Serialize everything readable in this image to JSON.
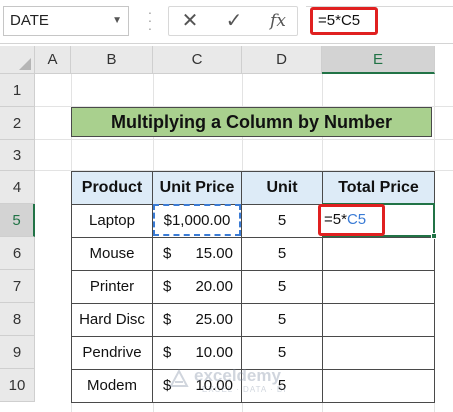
{
  "formula_bar": {
    "name_box": "DATE",
    "name_box_dropdown_icon": "chevron-down-icon",
    "cancel_icon": "close-icon",
    "enter_icon": "checkmark-icon",
    "fx_label": "fx",
    "formula": "=5*C5"
  },
  "columns": [
    "A",
    "B",
    "C",
    "D",
    "E"
  ],
  "rows": [
    "1",
    "2",
    "3",
    "4",
    "5",
    "6",
    "7",
    "8",
    "9",
    "10"
  ],
  "title": "Multiplying a Column by Number",
  "table": {
    "headers": [
      "Product",
      "Unit Price",
      "Unit",
      "Total Price"
    ],
    "rows": [
      {
        "product": "Laptop",
        "currency": "",
        "price": "$1,000.00",
        "unit": "5",
        "total": ""
      },
      {
        "product": "Mouse",
        "currency": "$",
        "price": "15.00",
        "unit": "5",
        "total": ""
      },
      {
        "product": "Printer",
        "currency": "$",
        "price": "20.00",
        "unit": "5",
        "total": ""
      },
      {
        "product": "Hard Disc",
        "currency": "$",
        "price": "25.00",
        "unit": "5",
        "total": ""
      },
      {
        "product": "Pendrive",
        "currency": "$",
        "price": "10.00",
        "unit": "5",
        "total": ""
      },
      {
        "product": "Modem",
        "currency": "$",
        "price": "10.00",
        "unit": "5",
        "total": ""
      }
    ]
  },
  "active_cell": {
    "prefix": "=5*",
    "reference": "C5"
  },
  "watermark": {
    "brand": "exceldemy",
    "tagline": "EXCEL · DATA · BI"
  },
  "colors": {
    "title_fill": "#a9d08e",
    "header_fill": "#ddebf7",
    "highlight_red": "#e02020",
    "reference_blue": "#3a7bd5",
    "excel_green": "#217346"
  }
}
